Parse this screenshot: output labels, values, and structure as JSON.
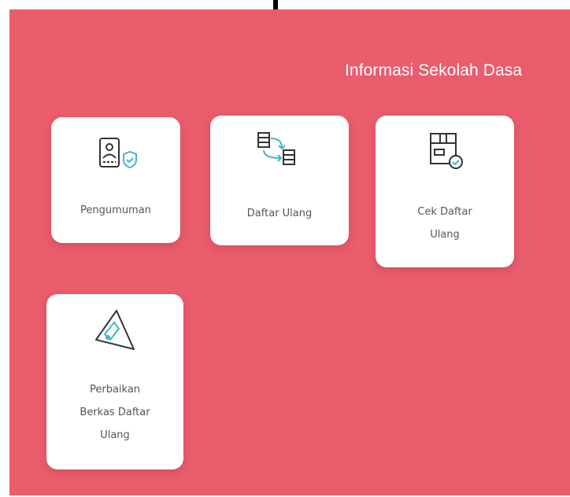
{
  "panel": {
    "heading": "Informasi Sekolah Dasa",
    "background_color": "#ea5d6d"
  },
  "annotation": {
    "icon": "down-arrow-icon"
  },
  "menu": [
    {
      "label": "Pengumuman",
      "icon": "id-card-shield-icon"
    },
    {
      "label": "Daftar Ulang",
      "icon": "data-transfer-icon"
    },
    {
      "label": "Cek Daftar\nUlang",
      "icon": "box-check-icon"
    },
    {
      "label": "Perbaikan\nBerkas Daftar\nUlang",
      "icon": "warning-tool-icon"
    }
  ],
  "colors": {
    "icon_stroke": "#333333",
    "icon_accent": "#3fb7c3",
    "card_text": "#555555"
  }
}
